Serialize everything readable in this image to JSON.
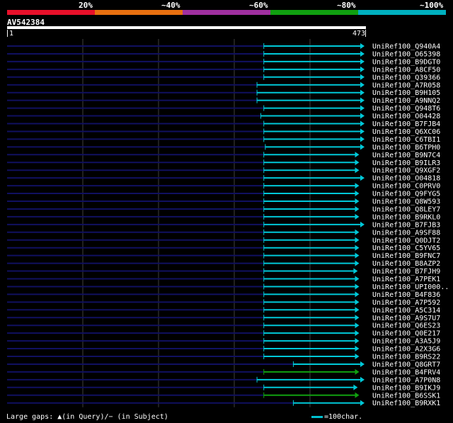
{
  "scale": {
    "labels": [
      "20%",
      "~40%",
      "~60%",
      "~80%",
      "~100%"
    ],
    "colors": [
      "#e8102a",
      "#e87010",
      "#a030a0",
      "#10a010",
      "#00b0c0"
    ]
  },
  "query": {
    "name": "AV542384",
    "start": "1",
    "end": "473",
    "length": 473
  },
  "colors": {
    "hit": "#00c8d8",
    "hit_low": "#10a010",
    "gap": "#101060",
    "grid": "#404040"
  },
  "hits": [
    {
      "name": "UniRef100_Q940A4",
      "start": 340,
      "end": 473,
      "color": "hit"
    },
    {
      "name": "UniRef100_O65398",
      "start": 340,
      "end": 473,
      "color": "hit"
    },
    {
      "name": "UniRef100_B9DGT0",
      "start": 340,
      "end": 473,
      "color": "hit"
    },
    {
      "name": "UniRef100_A8CF50",
      "start": 340,
      "end": 473,
      "color": "hit"
    },
    {
      "name": "UniRef100_Q39366",
      "start": 340,
      "end": 473,
      "color": "hit"
    },
    {
      "name": "UniRef100_A7R058",
      "start": 331,
      "end": 473,
      "color": "hit"
    },
    {
      "name": "UniRef100_B9H105",
      "start": 331,
      "end": 473,
      "color": "hit"
    },
    {
      "name": "UniRef100_A9NNQ2",
      "start": 331,
      "end": 473,
      "color": "hit"
    },
    {
      "name": "UniRef100_Q948T6",
      "start": 340,
      "end": 473,
      "color": "hit"
    },
    {
      "name": "UniRef100_O04428",
      "start": 336,
      "end": 473,
      "color": "hit"
    },
    {
      "name": "UniRef100_B7FJB4",
      "start": 340,
      "end": 473,
      "color": "hit"
    },
    {
      "name": "UniRef100_Q6XC06",
      "start": 340,
      "end": 473,
      "color": "hit"
    },
    {
      "name": "UniRef100_C6TBI1",
      "start": 340,
      "end": 473,
      "color": "hit"
    },
    {
      "name": "UniRef100_B6TPH0",
      "start": 342,
      "end": 473,
      "color": "hit"
    },
    {
      "name": "UniRef100_B9N7C4",
      "start": 340,
      "end": 466,
      "color": "hit"
    },
    {
      "name": "UniRef100_B9ILR3",
      "start": 340,
      "end": 466,
      "color": "hit"
    },
    {
      "name": "UniRef100_Q9XGF2",
      "start": 340,
      "end": 466,
      "color": "hit"
    },
    {
      "name": "UniRef100_O04818",
      "start": 340,
      "end": 473,
      "color": "hit"
    },
    {
      "name": "UniRef100_C0PRV0",
      "start": 340,
      "end": 466,
      "color": "hit"
    },
    {
      "name": "UniRef100_Q9FYG5",
      "start": 340,
      "end": 466,
      "color": "hit"
    },
    {
      "name": "UniRef100_Q8W593",
      "start": 340,
      "end": 466,
      "color": "hit"
    },
    {
      "name": "UniRef100_Q8LEY7",
      "start": 340,
      "end": 466,
      "color": "hit"
    },
    {
      "name": "UniRef100_B9RKL0",
      "start": 340,
      "end": 466,
      "color": "hit"
    },
    {
      "name": "UniRef100_B7FJB3",
      "start": 340,
      "end": 473,
      "color": "hit"
    },
    {
      "name": "UniRef100_A9SF88",
      "start": 340,
      "end": 466,
      "color": "hit"
    },
    {
      "name": "UniRef100_Q0DJT2",
      "start": 340,
      "end": 466,
      "color": "hit"
    },
    {
      "name": "UniRef100_C5YV65",
      "start": 340,
      "end": 466,
      "color": "hit"
    },
    {
      "name": "UniRef100_B9FNC7",
      "start": 340,
      "end": 466,
      "color": "hit"
    },
    {
      "name": "UniRef100_B8AZP2",
      "start": 340,
      "end": 466,
      "color": "hit"
    },
    {
      "name": "UniRef100_B7FJH9",
      "start": 340,
      "end": 464,
      "color": "hit"
    },
    {
      "name": "UniRef100_A7PEK1",
      "start": 340,
      "end": 466,
      "color": "hit"
    },
    {
      "name": "UniRef100_UPI000..",
      "start": 340,
      "end": 466,
      "color": "hit"
    },
    {
      "name": "UniRef100_B4F836",
      "start": 340,
      "end": 466,
      "color": "hit"
    },
    {
      "name": "UniRef100_A7P592",
      "start": 340,
      "end": 466,
      "color": "hit"
    },
    {
      "name": "UniRef100_A5C314",
      "start": 340,
      "end": 466,
      "color": "hit"
    },
    {
      "name": "UniRef100_A9S7U7",
      "start": 340,
      "end": 466,
      "color": "hit"
    },
    {
      "name": "UniRef100_Q6ES23",
      "start": 340,
      "end": 466,
      "color": "hit"
    },
    {
      "name": "UniRef100_Q0E217",
      "start": 340,
      "end": 466,
      "color": "hit"
    },
    {
      "name": "UniRef100_A3A5J9",
      "start": 340,
      "end": 466,
      "color": "hit"
    },
    {
      "name": "UniRef100_A2X3G6",
      "start": 340,
      "end": 466,
      "color": "hit"
    },
    {
      "name": "UniRef100_B9RS22",
      "start": 340,
      "end": 466,
      "color": "hit"
    },
    {
      "name": "UniRef100_Q8GRT7",
      "start": 379,
      "end": 473,
      "color": "hit"
    },
    {
      "name": "UniRef100_B4FRV4",
      "start": 340,
      "end": 466,
      "color": "hit_low"
    },
    {
      "name": "UniRef100_A7P0N8",
      "start": 331,
      "end": 473,
      "color": "hit"
    },
    {
      "name": "UniRef100_B9IKJ9",
      "start": 340,
      "end": 464,
      "color": "hit"
    },
    {
      "name": "UniRef100_B6SSK1",
      "start": 340,
      "end": 466,
      "color": "hit_low"
    },
    {
      "name": "UniRef100_B9RXK1",
      "start": 379,
      "end": 473,
      "color": "hit"
    }
  ],
  "footer": {
    "gaps_label": "Large gaps: ",
    "gaps_query": "▲(in Query)",
    "gaps_subject": "/− (in Subject)",
    "legend": "=100char."
  }
}
